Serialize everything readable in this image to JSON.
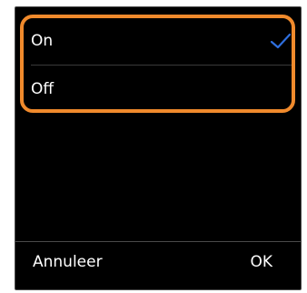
{
  "dialog": {
    "options": [
      {
        "label": "On",
        "selected": true
      },
      {
        "label": "Off",
        "selected": false
      }
    ],
    "cancel_label": "Annuleer",
    "ok_label": "OK"
  },
  "colors": {
    "background": "#000000",
    "text": "#ffffff",
    "checkmark": "#2f6fde",
    "highlight": "#f08a2c",
    "divider": "#3a3a3a"
  },
  "icons": {
    "selected": "checkmark-icon"
  }
}
